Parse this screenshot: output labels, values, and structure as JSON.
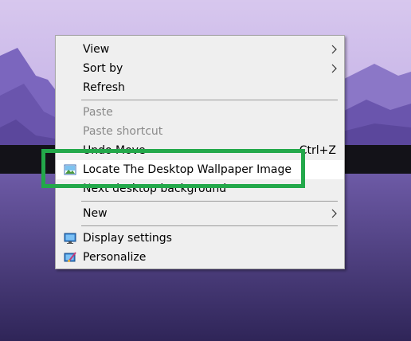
{
  "context_menu": {
    "items": [
      {
        "label": "View",
        "has_submenu": true,
        "enabled": true
      },
      {
        "label": "Sort by",
        "has_submenu": true,
        "enabled": true
      },
      {
        "label": "Refresh",
        "enabled": true
      },
      {
        "label": "Paste",
        "enabled": false
      },
      {
        "label": "Paste shortcut",
        "enabled": false
      },
      {
        "label": "Undo Move",
        "shortcut": "Ctrl+Z",
        "enabled": true
      },
      {
        "label": "Locate The Desktop Wallpaper Image",
        "icon": "picture-icon",
        "enabled": true,
        "highlighted": true
      },
      {
        "label": "Next desktop background",
        "enabled": true
      },
      {
        "label": "New",
        "has_submenu": true,
        "enabled": true
      },
      {
        "label": "Display settings",
        "icon": "display-settings-icon",
        "enabled": true
      },
      {
        "label": "Personalize",
        "icon": "personalize-icon",
        "enabled": true
      }
    ]
  },
  "colors": {
    "annotation_box": "#23a84a",
    "menu_background": "#efefef",
    "highlight_background": "#ffffff",
    "disabled_text": "#8a8a8a"
  }
}
